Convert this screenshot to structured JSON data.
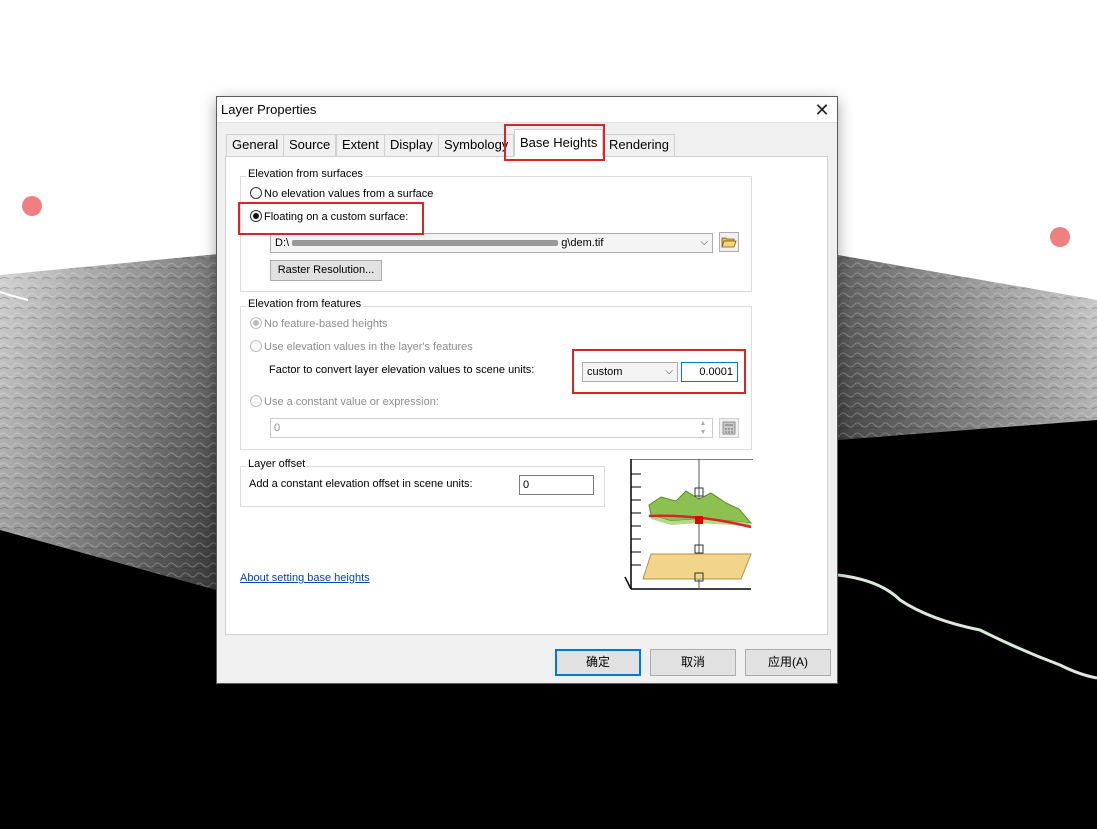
{
  "dialog": {
    "title": "Layer Properties",
    "close_glyph": "✕",
    "tabs": [
      {
        "label": "General"
      },
      {
        "label": "Source"
      },
      {
        "label": "Extent"
      },
      {
        "label": "Display"
      },
      {
        "label": "Symbology"
      },
      {
        "label": "Base Heights",
        "active": true
      },
      {
        "label": "Rendering"
      }
    ]
  },
  "surfaces": {
    "legend": "Elevation from surfaces",
    "option_none": "No elevation values from a surface",
    "option_custom": "Floating on a custom surface:",
    "selected": "custom",
    "surface_path_prefix": "D:\\",
    "surface_path_suffix": "g\\dem.tif",
    "raster_button": "Raster Resolution..."
  },
  "features": {
    "legend": "Elevation from features",
    "option_no_heights": "No feature-based heights",
    "option_layer_values": "Use elevation values in the layer's features",
    "factor_label": "Factor to convert layer elevation values to scene units:",
    "factor_unit": "custom",
    "factor_value": "0.0001",
    "option_constant": "Use a constant value or expression:",
    "constant_value": "0"
  },
  "offset": {
    "legend": "Layer offset",
    "label": "Add a constant elevation offset in scene units:",
    "value": "0"
  },
  "help_link": "About setting base heights",
  "buttons": {
    "ok": "确定",
    "cancel": "取消",
    "apply": "应用(A)"
  },
  "colors": {
    "highlight": "#d9242a",
    "marker": "#f08080",
    "link": "#0645ad"
  },
  "icons": {
    "open_folder": "folder-open-icon",
    "calculator": "calculator-icon",
    "close": "close-icon"
  }
}
